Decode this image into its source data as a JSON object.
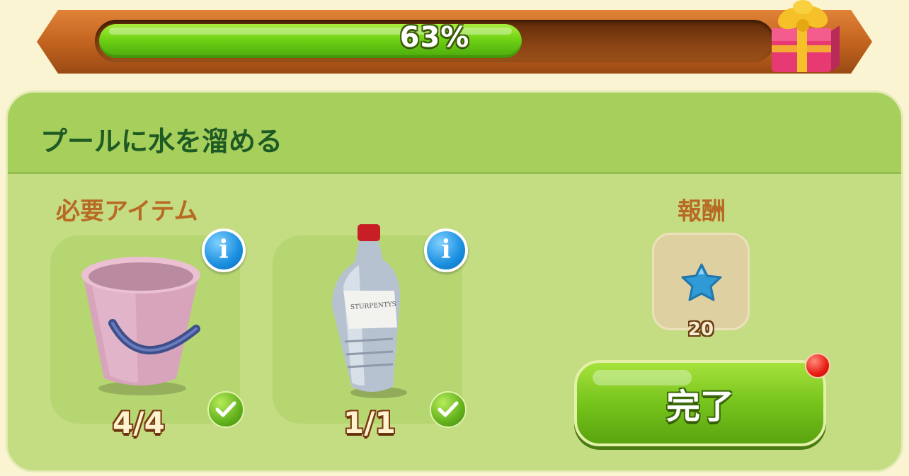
{
  "progress": {
    "value_percent": 63,
    "label": "63%",
    "fill_color": "#6fd214",
    "reward_icon": "gift-box-icon"
  },
  "task": {
    "title": "プールに水を溜める",
    "required_label": "必要アイテム",
    "reward_label": "報酬",
    "items": [
      {
        "icon": "pink-bucket-icon",
        "count": "4/4",
        "complete": true,
        "info_icon": "info-icon",
        "check_icon": "check-icon"
      },
      {
        "icon": "water-bottle-icon",
        "count": "1/1",
        "complete": true,
        "info_icon": "info-icon",
        "check_icon": "check-icon",
        "bottle_label": "STURPENTYS"
      }
    ],
    "reward": {
      "icon": "blue-star-icon",
      "amount": "20"
    },
    "complete_button": {
      "label": "完了",
      "has_notification": true
    }
  },
  "colors": {
    "panel": "#c4dc82",
    "header": "#a7cf5c",
    "title_text": "#1e5a24",
    "section_label": "#b86a24",
    "button_green": "#76c41c",
    "notification": "#e81c14",
    "info_blue": "#1a8fe0"
  }
}
